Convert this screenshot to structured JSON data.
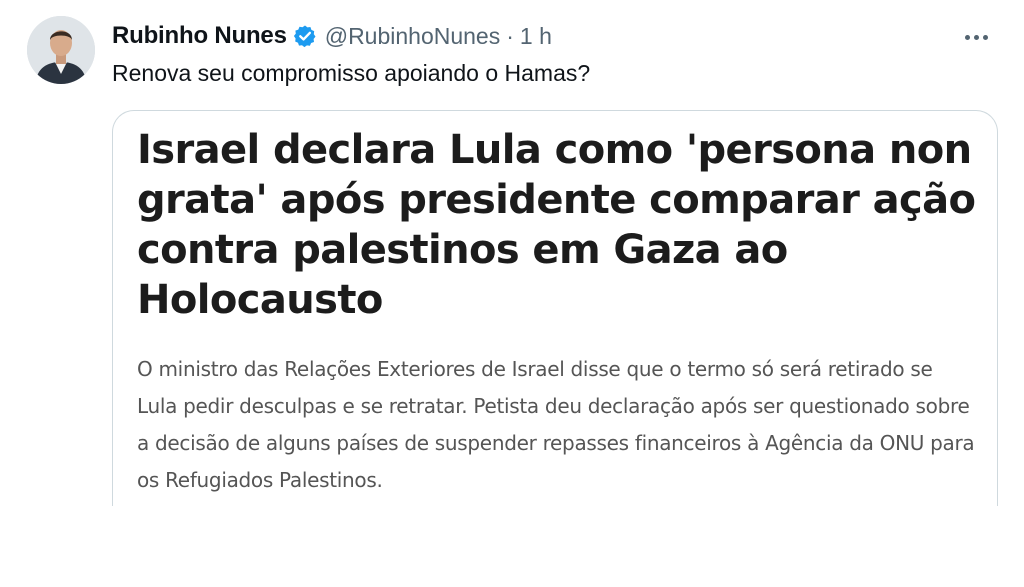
{
  "author": {
    "name": "Rubinho Nunes",
    "handle": "@RubinhoNunes",
    "separator": "·",
    "time": "1 h",
    "verified_icon": "verified-badge-icon",
    "avatar": "profile-photo"
  },
  "more_icon": "more-horizontal-icon",
  "tweet_text": "Renova seu compromisso apoiando o Hamas?",
  "card": {
    "headline": "Israel declara Lula como 'persona non grata' após presidente comparar ação contra palestinos em Gaza ao Holocausto",
    "summary": "O ministro das Relações Exteriores de Israel disse que o termo só será retirado se Lula pedir desculpas e se retratar. Petista deu declaração após ser questionado sobre a decisão de alguns países de suspender repasses financeiros à Agência da ONU para os Refugiados Palestinos."
  },
  "colors": {
    "verified": "#1d9bf0",
    "secondary_text": "#536471",
    "border": "#cfd9de"
  }
}
